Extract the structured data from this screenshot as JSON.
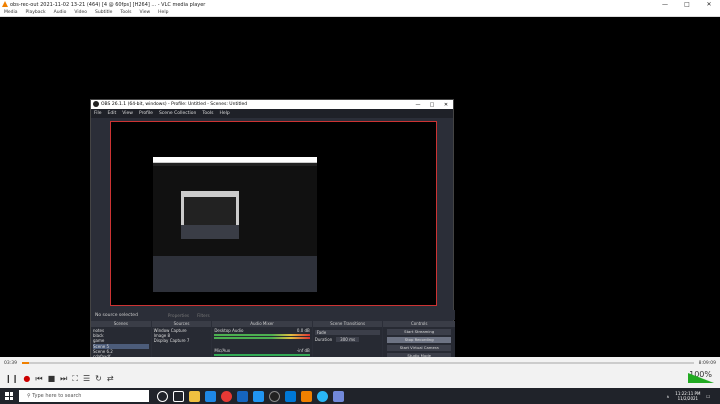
{
  "vlc": {
    "title": "obs-rec-out 2021-11-02 13-21 (464) [4 @ 60fps] [H264] ... - VLC media player",
    "menu": [
      "Media",
      "Playback",
      "Audio",
      "Video",
      "Subtitle",
      "Tools",
      "View",
      "Help"
    ],
    "time_elapsed": "03:39",
    "time_total": "8:09:09",
    "progress": 0.01,
    "volume_pct": "100%"
  },
  "obs": {
    "title": "OBS 26.1.1 (64-bit, windows) - Profile: Untitled - Scenes: Untitled",
    "menu": [
      "File",
      "Edit",
      "View",
      "Profile",
      "Scene Collection",
      "Tools",
      "Help"
    ],
    "no_source": "No source selected",
    "properties_btn": "Properties",
    "filters_btn": "Filters",
    "docks": {
      "scenes": {
        "title": "Scenes",
        "items": [
          "notes",
          "black",
          "game",
          "Scene 5",
          "Scene 6.2",
          "cdafaxdf",
          "dsfsdfsdf"
        ]
      },
      "sources": {
        "title": "Sources",
        "items": [
          "Window Capture",
          "Image 8",
          "Display Capture 7"
        ]
      },
      "mixer": {
        "title": "Audio Mixer",
        "desktop": "Desktop Audio",
        "desktop_db": "0.0 dB",
        "mic": "Mic/Aux",
        "mic_db": "-inf dB"
      },
      "transitions": {
        "title": "Scene Transitions",
        "type": "Fade",
        "duration_label": "Duration",
        "duration": "300 ms"
      },
      "controls": {
        "title": "Controls",
        "buttons": [
          "Start Streaming",
          "Stop Recording",
          "Start Virtual Camera",
          "Studio Mode",
          "Settings",
          "Exit"
        ]
      }
    },
    "status": {
      "live": "LIVE: 00:00:00",
      "rec": "REC: 00:03:36",
      "cpu": "CPU: 0.5%, 30.00 fps"
    }
  },
  "taskbar": {
    "search_placeholder": "Type here to search",
    "time": "11:22:11 PM",
    "date": "11/2/2021"
  }
}
